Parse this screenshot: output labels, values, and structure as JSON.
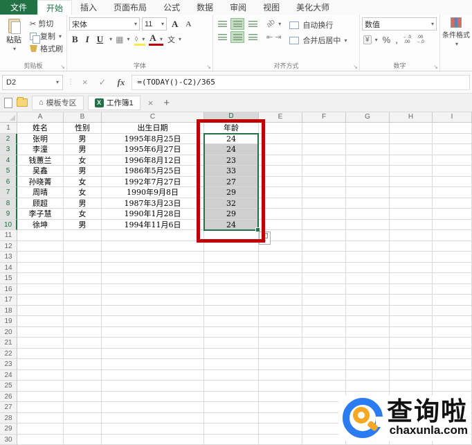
{
  "colors": {
    "excel_green": "#217346",
    "annotation_red": "#c00000",
    "selection_gray": "#cfcfcf",
    "align_highlight_green": "#c7dfc7",
    "logo_blue": "#2b7cf0",
    "logo_orange": "#f7a823"
  },
  "ribbon_tabs": {
    "file": "文件",
    "items": [
      "开始",
      "插入",
      "页面布局",
      "公式",
      "数据",
      "审阅",
      "视图",
      "美化大师"
    ],
    "active": "开始"
  },
  "ribbon": {
    "clipboard": {
      "group_label": "剪贴板",
      "paste": "粘贴",
      "cut": "剪切",
      "copy": "复制",
      "format_painter": "格式刷"
    },
    "font": {
      "group_label": "字体",
      "family": "宋体",
      "size": "11",
      "bold": "B",
      "italic": "I",
      "underline": "U",
      "grow": "A",
      "shrink": "A",
      "phonetic": "文"
    },
    "alignment": {
      "group_label": "对齐方式",
      "orientation": "ab",
      "wrap_text": "自动换行",
      "merge_center": "合并后居中"
    },
    "number": {
      "group_label": "数字",
      "format": "数值",
      "currency": "¥",
      "percent": "%",
      "comma": ",",
      "inc_decimal_top": "←.0",
      "inc_decimal_bottom": ".00",
      "dec_decimal_top": ".00",
      "dec_decimal_bottom": "→.0"
    },
    "conditional_formatting": "条件格式"
  },
  "formula_bar": {
    "name_box": "D2",
    "formula": "=(TODAY()-C2)/365"
  },
  "file_tab_bar": {
    "template_tab": "模板专区",
    "workbook_tab": "工作簿1"
  },
  "sheet": {
    "column_headers": [
      "A",
      "B",
      "C",
      "D",
      "E",
      "F",
      "G",
      "H",
      "I"
    ],
    "selected_column": "D",
    "selected_range": "D2:D10",
    "row_count": 30,
    "table": {
      "headers": [
        "姓名",
        "性别",
        "出生日期",
        "年龄"
      ],
      "rows": [
        [
          "张明",
          "男",
          "1995年8月25日",
          "24"
        ],
        [
          "李潼",
          "男",
          "1995年6月27日",
          "24"
        ],
        [
          "钱蕙兰",
          "女",
          "1996年8月12日",
          "23"
        ],
        [
          "吴鑫",
          "男",
          "1986年5月25日",
          "33"
        ],
        [
          "孙晓菁",
          "女",
          "1992年7月27日",
          "27"
        ],
        [
          "周晴",
          "女",
          "1990年9月8日",
          "29"
        ],
        [
          "顾超",
          "男",
          "1987年3月23日",
          "32"
        ],
        [
          "李子慧",
          "女",
          "1990年1月28日",
          "29"
        ],
        [
          "徐坤",
          "男",
          "1994年11月6日",
          "24"
        ]
      ]
    }
  },
  "watermark": {
    "title": "查询啦",
    "domain": "chaxunla.com"
  },
  "icons": {
    "dropdown": "▾",
    "dots": "⋮",
    "cancel": "×",
    "confirm": "✓",
    "fx": "fx",
    "cut": "✂",
    "border": "▦",
    "wrap": "↩",
    "home": "⌂",
    "close": "×",
    "plus": "+",
    "launcher": "↘",
    "grow_caret": "▲",
    "shrink_caret": "▼"
  }
}
